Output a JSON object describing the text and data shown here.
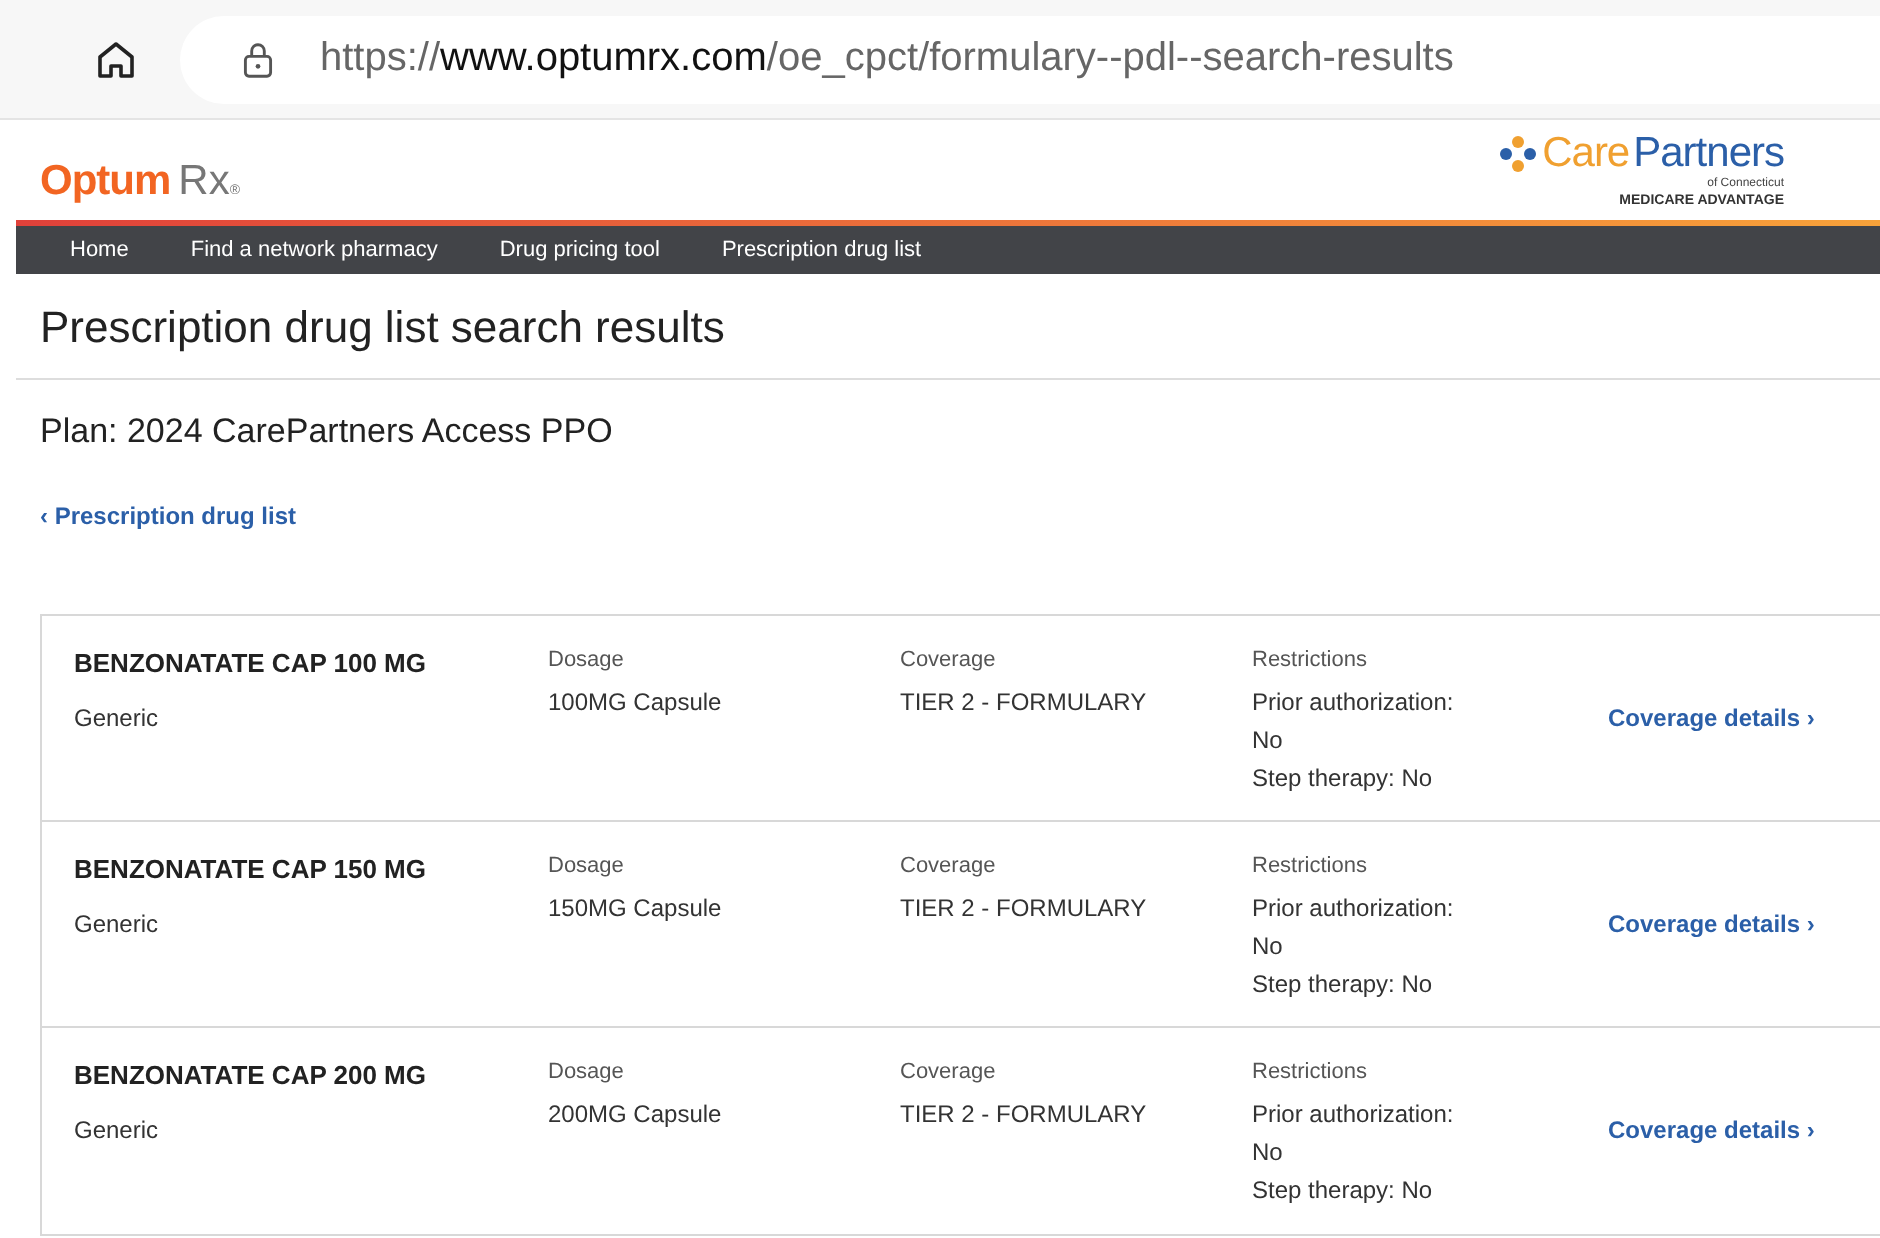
{
  "browser": {
    "url_scheme": "https://",
    "url_host": "www.optumrx.com",
    "url_path": "/oe_cpct/formulary--pdl--search-results"
  },
  "header": {
    "logo_brand": "Optum",
    "logo_product": "Rx",
    "logo_mark": "®",
    "partner_logo_care": "Care",
    "partner_logo_partners": "Partners",
    "partner_logo_region": "of Connecticut",
    "partner_logo_tagline": "MEDICARE ADVANTAGE"
  },
  "nav": [
    {
      "label": "Home"
    },
    {
      "label": "Find a network pharmacy"
    },
    {
      "label": "Drug pricing tool"
    },
    {
      "label": "Prescription drug list"
    }
  ],
  "page_title": "Prescription drug list search results",
  "plan": "Plan: 2024 CarePartners Access PPO",
  "back_link": "‹ Prescription drug list",
  "results": [
    {
      "name": "BENZONATATE CAP 100 MG",
      "type": "Generic",
      "dosage_label": "Dosage",
      "dosage": "100MG Capsule",
      "coverage_label": "Coverage",
      "coverage": "TIER 2 - FORMULARY",
      "restrictions_label": "Restrictions",
      "prior_authorization": "Prior authorization: No",
      "step_therapy": "Step therapy: No",
      "link": "Coverage details ›"
    },
    {
      "name": "BENZONATATE CAP 150 MG",
      "type": "Generic",
      "dosage_label": "Dosage",
      "dosage": "150MG Capsule",
      "coverage_label": "Coverage",
      "coverage": "TIER 2 - FORMULARY",
      "restrictions_label": "Restrictions",
      "prior_authorization": "Prior authorization: No",
      "step_therapy": "Step therapy: No",
      "link": "Coverage details ›"
    },
    {
      "name": "BENZONATATE CAP 200 MG",
      "type": "Generic",
      "dosage_label": "Dosage",
      "dosage": "200MG Capsule",
      "coverage_label": "Coverage",
      "coverage": "TIER 2 - FORMULARY",
      "restrictions_label": "Restrictions",
      "prior_authorization": "Prior authorization: No",
      "step_therapy": "Step therapy: No",
      "link": "Coverage details ›"
    }
  ]
}
